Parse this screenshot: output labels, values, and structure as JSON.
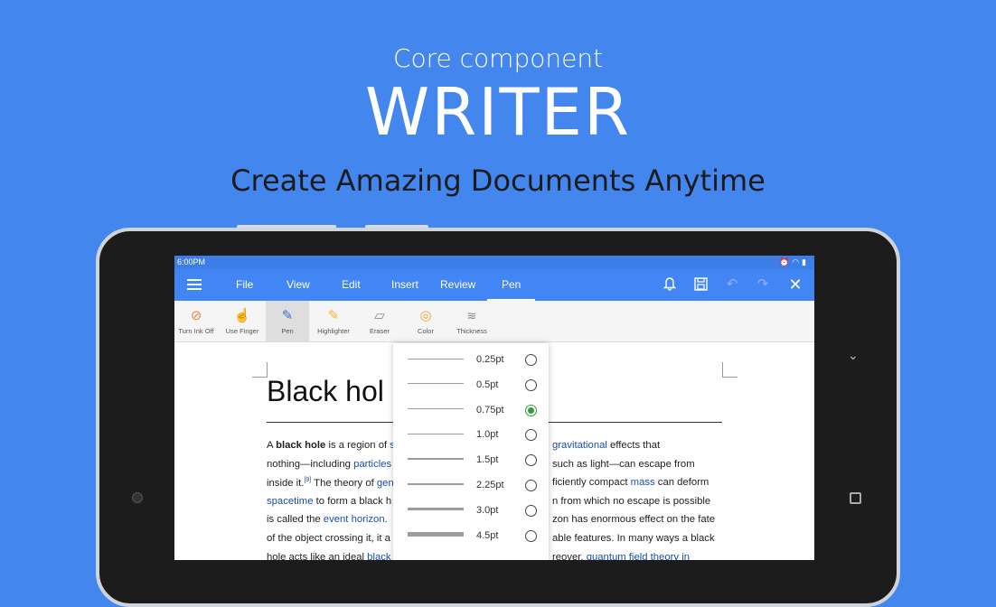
{
  "hero": {
    "subtitle": "Core component",
    "title": "WRITER",
    "tagline": "Create Amazing Documents Anytime"
  },
  "status_bar": {
    "time": "6:00PM",
    "icons": [
      "alarm-icon",
      "wifi-icon",
      "battery-icon"
    ]
  },
  "menu": {
    "tabs": [
      "File",
      "View",
      "Edit",
      "Insert",
      "Review",
      "Pen"
    ],
    "active_tab": "Pen",
    "actions": [
      "bell-icon",
      "save-icon",
      "undo-icon",
      "redo-icon",
      "close-icon"
    ]
  },
  "ribbon": {
    "tools": [
      {
        "label": "Turn Ink Off",
        "icon": "ink-off-icon"
      },
      {
        "label": "Use Finger",
        "icon": "finger-icon"
      },
      {
        "label": "Pen",
        "icon": "pen-icon"
      },
      {
        "label": "Highlighter",
        "icon": "highlighter-icon"
      },
      {
        "label": "Eraser",
        "icon": "eraser-icon"
      },
      {
        "label": "Color",
        "icon": "color-wheel-icon"
      },
      {
        "label": "Thickness",
        "icon": "thickness-icon"
      }
    ],
    "selected": "Pen"
  },
  "document": {
    "heading": "Black hol",
    "lines": [
      {
        "segments": [
          {
            "t": "A "
          },
          {
            "t": "black hole",
            "b": true
          },
          {
            "t": " is a region of "
          },
          {
            "t": "s",
            "link": true
          }
        ]
      },
      {
        "segments": [
          {
            "t": "nothing—including "
          },
          {
            "t": "particles",
            "link": true
          }
        ]
      },
      {
        "segments": [
          {
            "t": "inside it."
          },
          {
            "t": "[9]",
            "sup": true
          },
          {
            "t": " The theory of "
          },
          {
            "t": "gen",
            "link": true
          }
        ]
      },
      {
        "segments": [
          {
            "t": "spacetime",
            "link": true
          },
          {
            "t": " to form a black h"
          }
        ]
      },
      {
        "segments": [
          {
            "t": "is called the "
          },
          {
            "t": "event horizon",
            "link": true
          },
          {
            "t": ". "
          }
        ]
      },
      {
        "segments": [
          {
            "t": "of the object crossing it, it a"
          }
        ]
      },
      {
        "segments": [
          {
            "t": "hole acts like an ideal "
          },
          {
            "t": "black",
            "link": true
          }
        ]
      }
    ],
    "right_lines": [
      {
        "segments": [
          {
            "t": "gravitational",
            "link": true
          },
          {
            "t": " effects that"
          }
        ]
      },
      {
        "segments": [
          {
            "t": "such as light—can escape from"
          }
        ]
      },
      {
        "segments": [
          {
            "t": "ficiently compact "
          },
          {
            "t": "mass",
            "link": true
          },
          {
            "t": " can deform"
          }
        ]
      },
      {
        "segments": [
          {
            "t": "n from which no escape is possible"
          }
        ]
      },
      {
        "segments": [
          {
            "t": "zon has enormous effect on the fate"
          }
        ]
      },
      {
        "segments": [
          {
            "t": "able features. In many ways a black"
          }
        ]
      },
      {
        "segments": [
          {
            "t": "reover, "
          },
          {
            "t": "quantum field theory in",
            "link": true
          }
        ]
      }
    ]
  },
  "thickness_dropdown": {
    "options": [
      {
        "label": "0.25pt",
        "value": 0.25
      },
      {
        "label": "0.5pt",
        "value": 0.5
      },
      {
        "label": "0.75pt",
        "value": 0.75
      },
      {
        "label": "1.0pt",
        "value": 1.0
      },
      {
        "label": "1.5pt",
        "value": 1.5
      },
      {
        "label": "2.25pt",
        "value": 2.25
      },
      {
        "label": "3.0pt",
        "value": 3.0
      },
      {
        "label": "4.5pt",
        "value": 4.5
      }
    ],
    "selected": "0.75pt",
    "accent_color": "#2e9c3e"
  },
  "colors": {
    "background": "#4386ee",
    "toolbar": "#4285f4",
    "link": "#1a4fa8"
  }
}
